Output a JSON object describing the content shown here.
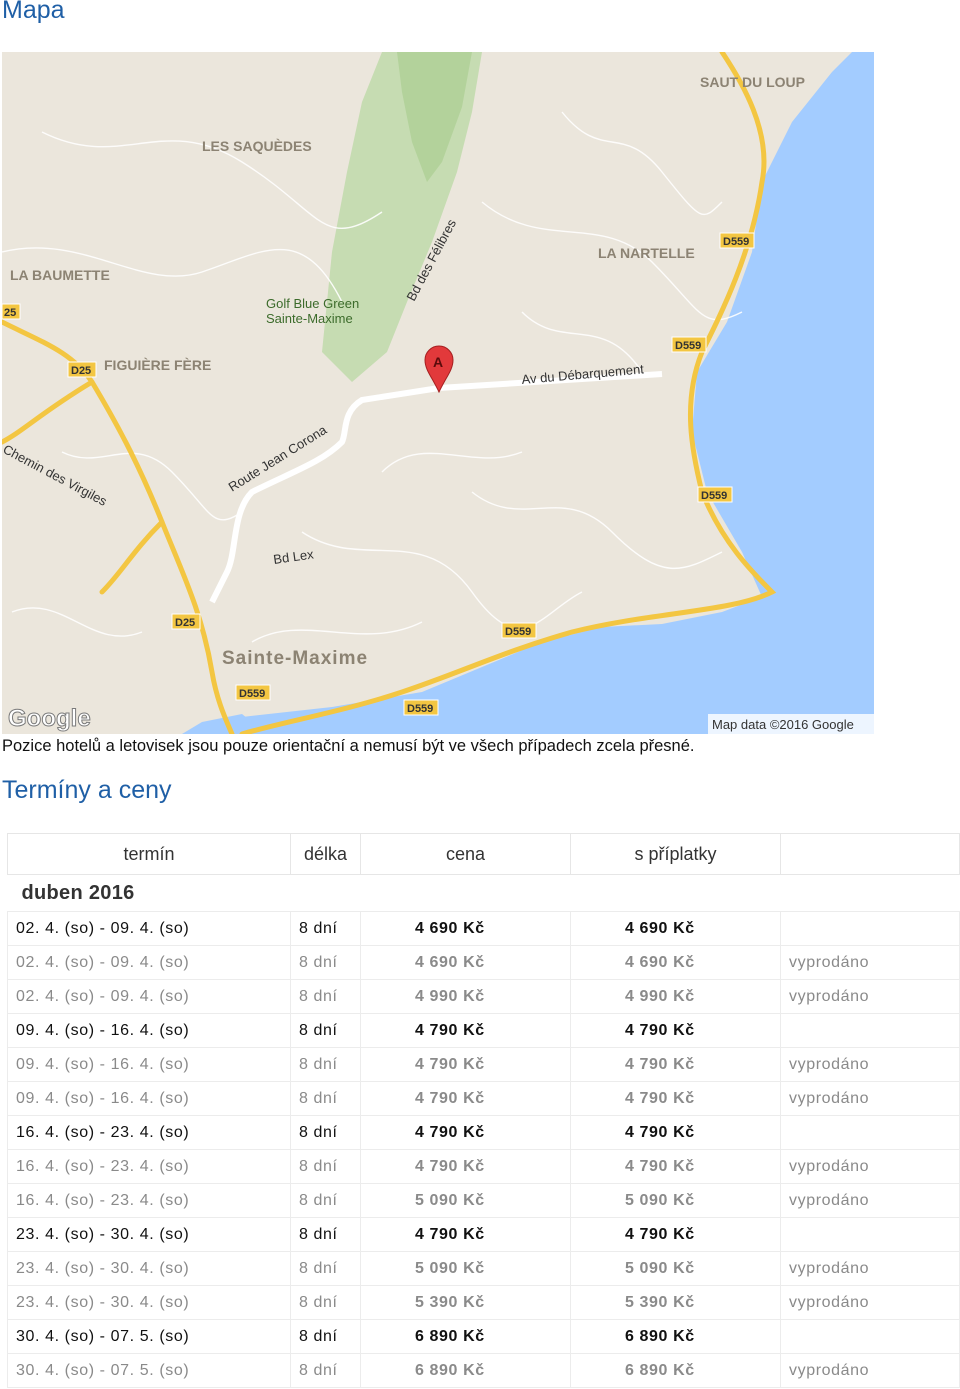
{
  "headings": {
    "map": "Mapa",
    "terms": "Termíny a ceny"
  },
  "map": {
    "note": "Pozice hotelů a letovisek jsou pouze orientační a nemusí být ve všech případech zcela přesné.",
    "marker": "A",
    "logo": "Google",
    "attribution": "Map data ©2016 Google",
    "place_labels": [
      "LES SAQUÈDES",
      "SAUT DU LOUP",
      "LA BAUMETTE",
      "LA NARTELLE",
      "Golf Blue Green",
      "Sainte-Maxime",
      "FIGUIÈRE FÈRE",
      "Sainte-Maxime"
    ],
    "road_labels": [
      "Bd des Félibres",
      "Av du Débarquement",
      "Route Jean Corona",
      "Chemin des Virgiles",
      "Bd Lex"
    ],
    "shields": [
      "D559",
      "D559",
      "D559",
      "D559",
      "D559",
      "D25",
      "D25",
      "25"
    ]
  },
  "table": {
    "headers": [
      "termín",
      "délka",
      "cena",
      "s příplatky",
      ""
    ],
    "month": "duben 2016",
    "rows": [
      {
        "term": "02. 4. (so) - 09. 4. (so)",
        "length": "8 dní",
        "price": "4 690 Kč",
        "price_extra": "4 690 Kč",
        "status": ""
      },
      {
        "term": "02. 4. (so) - 09. 4. (so)",
        "length": "8 dní",
        "price": "4 690 Kč",
        "price_extra": "4 690 Kč",
        "status": "vyprodáno"
      },
      {
        "term": "02. 4. (so) - 09. 4. (so)",
        "length": "8 dní",
        "price": "4 990 Kč",
        "price_extra": "4 990 Kč",
        "status": "vyprodáno"
      },
      {
        "term": "09. 4. (so) - 16. 4. (so)",
        "length": "8 dní",
        "price": "4 790 Kč",
        "price_extra": "4 790 Kč",
        "status": ""
      },
      {
        "term": "09. 4. (so) - 16. 4. (so)",
        "length": "8 dní",
        "price": "4 790 Kč",
        "price_extra": "4 790 Kč",
        "status": "vyprodáno"
      },
      {
        "term": "09. 4. (so) - 16. 4. (so)",
        "length": "8 dní",
        "price": "4 790 Kč",
        "price_extra": "4 790 Kč",
        "status": "vyprodáno"
      },
      {
        "term": "16. 4. (so) - 23. 4. (so)",
        "length": "8 dní",
        "price": "4 790 Kč",
        "price_extra": "4 790 Kč",
        "status": ""
      },
      {
        "term": "16. 4. (so) - 23. 4. (so)",
        "length": "8 dní",
        "price": "4 790 Kč",
        "price_extra": "4 790 Kč",
        "status": "vyprodáno"
      },
      {
        "term": "16. 4. (so) - 23. 4. (so)",
        "length": "8 dní",
        "price": "5 090 Kč",
        "price_extra": "5 090 Kč",
        "status": "vyprodáno"
      },
      {
        "term": "23. 4. (so) - 30. 4. (so)",
        "length": "8 dní",
        "price": "4 790 Kč",
        "price_extra": "4 790 Kč",
        "status": ""
      },
      {
        "term": "23. 4. (so) - 30. 4. (so)",
        "length": "8 dní",
        "price": "5 090 Kč",
        "price_extra": "5 090 Kč",
        "status": "vyprodáno"
      },
      {
        "term": "23. 4. (so) - 30. 4. (so)",
        "length": "8 dní",
        "price": "5 390 Kč",
        "price_extra": "5 390 Kč",
        "status": "vyprodáno"
      },
      {
        "term": "30. 4. (so) - 07. 5. (so)",
        "length": "8 dní",
        "price": "6 890 Kč",
        "price_extra": "6 890 Kč",
        "status": ""
      },
      {
        "term": "30. 4. (so) - 07. 5. (so)",
        "length": "8 dní",
        "price": "6 890 Kč",
        "price_extra": "6 890 Kč",
        "status": "vyprodáno"
      }
    ]
  }
}
